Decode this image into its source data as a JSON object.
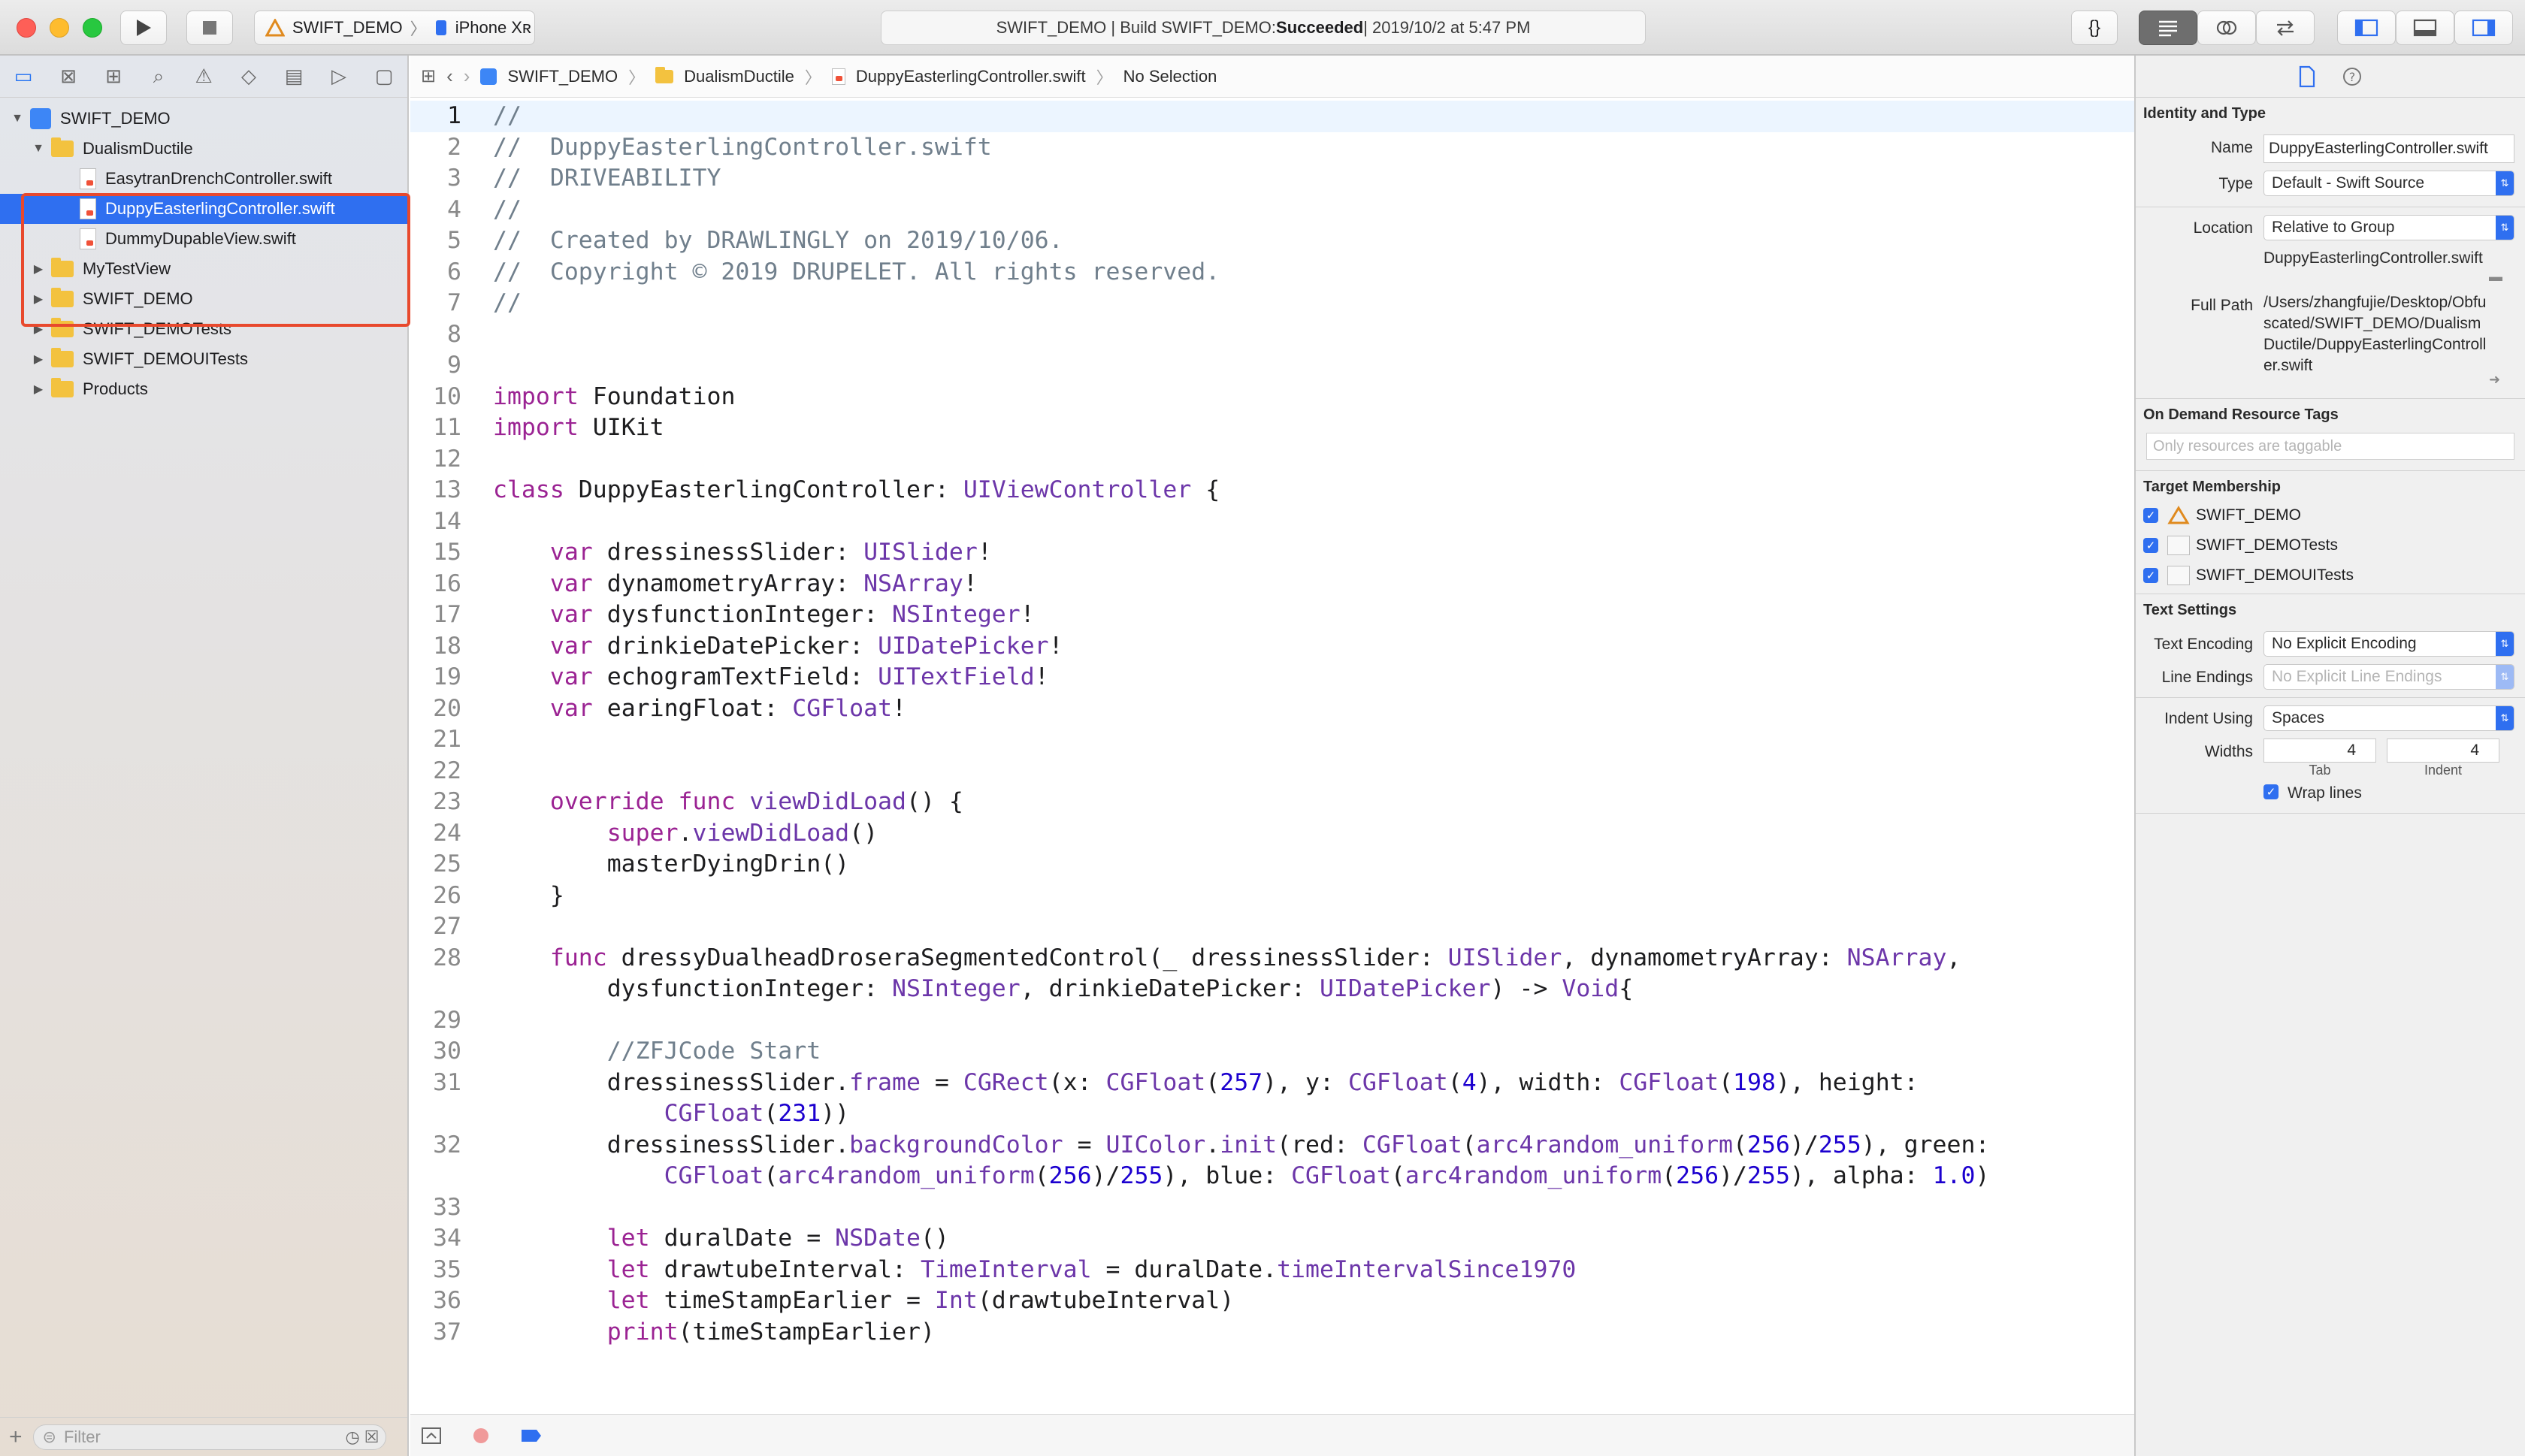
{
  "toolbar": {
    "scheme": "SWIFT_DEMO",
    "scheme_sep": "〉",
    "device": "iPhone Xʀ",
    "status_prefix": "SWIFT_DEMO | Build SWIFT_DEMO: ",
    "status_result": "Succeeded",
    "status_suffix": " | 2019/10/2 at 5:47 PM",
    "code_brackets": "{}"
  },
  "navigator": {
    "filter_placeholder": "Filter",
    "items": [
      {
        "label": "SWIFT_DEMO",
        "kind": "project",
        "level": 0,
        "disclosure": "▼"
      },
      {
        "label": "DualismDuctile",
        "kind": "folder",
        "level": 1,
        "disclosure": "▼"
      },
      {
        "label": "EasytranDrenchController.swift",
        "kind": "swift",
        "level": 2
      },
      {
        "label": "DuppyEasterlingController.swift",
        "kind": "swift",
        "level": 2,
        "selected": true
      },
      {
        "label": "DummyDupableView.swift",
        "kind": "swift",
        "level": 2
      },
      {
        "label": "MyTestView",
        "kind": "folder",
        "level": 1,
        "disclosure": "▶"
      },
      {
        "label": "SWIFT_DEMO",
        "kind": "folder",
        "level": 1,
        "disclosure": "▶"
      },
      {
        "label": "SWIFT_DEMOTests",
        "kind": "folder",
        "level": 1,
        "disclosure": "▶"
      },
      {
        "label": "SWIFT_DEMOUITests",
        "kind": "folder",
        "level": 1,
        "disclosure": "▶"
      },
      {
        "label": "Products",
        "kind": "folder",
        "level": 1,
        "disclosure": "▶"
      }
    ]
  },
  "jumpbar": {
    "crumbs": [
      "SWIFT_DEMO",
      "DualismDuctile",
      "DuppyEasterlingController.swift",
      "No Selection"
    ],
    "sep": "〉"
  },
  "editor": {
    "lines": [
      {
        "n": "1",
        "t": "//"
      },
      {
        "n": "2",
        "t": "//  DuppyEasterlingController.swift"
      },
      {
        "n": "3",
        "t": "//  DRIVEABILITY"
      },
      {
        "n": "4",
        "t": "//"
      },
      {
        "n": "5",
        "t": "//  Created by DRAWLINGLY on 2019/10/06."
      },
      {
        "n": "6",
        "t": "//  Copyright © 2019 DRUPELET. All rights reserved."
      },
      {
        "n": "7",
        "t": "//"
      },
      {
        "n": "8",
        "t": ""
      },
      {
        "n": "9",
        "t": ""
      },
      {
        "n": "10",
        "t": "import Foundation"
      },
      {
        "n": "11",
        "t": "import UIKit"
      },
      {
        "n": "12",
        "t": ""
      },
      {
        "n": "13",
        "t": "class DuppyEasterlingController: UIViewController {"
      },
      {
        "n": "14",
        "t": ""
      },
      {
        "n": "15",
        "t": "    var dressinessSlider: UISlider!"
      },
      {
        "n": "16",
        "t": "    var dynamometryArray: NSArray!"
      },
      {
        "n": "17",
        "t": "    var dysfunctionInteger: NSInteger!"
      },
      {
        "n": "18",
        "t": "    var drinkieDatePicker: UIDatePicker!"
      },
      {
        "n": "19",
        "t": "    var echogramTextField: UITextField!"
      },
      {
        "n": "20",
        "t": "    var earingFloat: CGFloat!"
      },
      {
        "n": "21",
        "t": ""
      },
      {
        "n": "22",
        "t": ""
      },
      {
        "n": "23",
        "t": "    override func viewDidLoad() {"
      },
      {
        "n": "24",
        "t": "        super.viewDidLoad()"
      },
      {
        "n": "25",
        "t": "        masterDyingDrin()"
      },
      {
        "n": "26",
        "t": "    }"
      },
      {
        "n": "27",
        "t": ""
      },
      {
        "n": "28",
        "t": "    func dressyDualheadDroseraSegmentedControl(_ dressinessSlider: UISlider, dynamometryArray: NSArray,"
      },
      {
        "n": "",
        "t": "        dysfunctionInteger: NSInteger, drinkieDatePicker: UIDatePicker) -> Void{"
      },
      {
        "n": "29",
        "t": ""
      },
      {
        "n": "30",
        "t": "        //ZFJCode Start"
      },
      {
        "n": "31",
        "t": "        dressinessSlider.frame = CGRect(x: CGFloat(257), y: CGFloat(4), width: CGFloat(198), height:"
      },
      {
        "n": "",
        "t": "            CGFloat(231))"
      },
      {
        "n": "32",
        "t": "        dressinessSlider.backgroundColor = UIColor.init(red: CGFloat(arc4random_uniform(256)/255), green:"
      },
      {
        "n": "",
        "t": "            CGFloat(arc4random_uniform(256)/255), blue: CGFloat(arc4random_uniform(256)/255), alpha: 1.0)"
      },
      {
        "n": "33",
        "t": ""
      },
      {
        "n": "34",
        "t": "        let duralDate = NSDate()"
      },
      {
        "n": "35",
        "t": "        let drawtubeInterval: TimeInterval = duralDate.timeIntervalSince1970"
      },
      {
        "n": "36",
        "t": "        let timeStampEarlier = Int(drawtubeInterval)"
      },
      {
        "n": "37",
        "t": "        print(timeStampEarlier)"
      }
    ]
  },
  "inspector": {
    "identity_title": "Identity and Type",
    "name_label": "Name",
    "name_value": "DuppyEasterlingController.swift",
    "type_label": "Type",
    "type_value": "Default - Swift Source",
    "location_label": "Location",
    "location_value": "Relative to Group",
    "location_file": "DuppyEasterlingController.swift",
    "fullpath_label": "Full Path",
    "fullpath_value": "/Users/zhangfujie/Desktop/Obfuscated/SWIFT_DEMO/DualismDuctile/DuppyEasterlingController.swift",
    "odr_title": "On Demand Resource Tags",
    "odr_placeholder": "Only resources are taggable",
    "target_title": "Target Membership",
    "targets": [
      "SWIFT_DEMO",
      "SWIFT_DEMOTests",
      "SWIFT_DEMOUITests"
    ],
    "text_title": "Text Settings",
    "encoding_label": "Text Encoding",
    "encoding_value": "No Explicit Encoding",
    "line_endings_label": "Line Endings",
    "line_endings_value": "No Explicit Line Endings",
    "indent_label": "Indent Using",
    "indent_value": "Spaces",
    "widths_label": "Widths",
    "tab_value": "4",
    "indent_width_value": "4",
    "tab_caption": "Tab",
    "indent_caption": "Indent",
    "wrap_label": "Wrap lines"
  },
  "colors": {
    "keyword": "#9b2393",
    "type": "#6c36a9",
    "comment": "#707f8c",
    "number": "#1c00cf",
    "selection": "#2f6ff0",
    "annotation_box": "#e8492d"
  }
}
